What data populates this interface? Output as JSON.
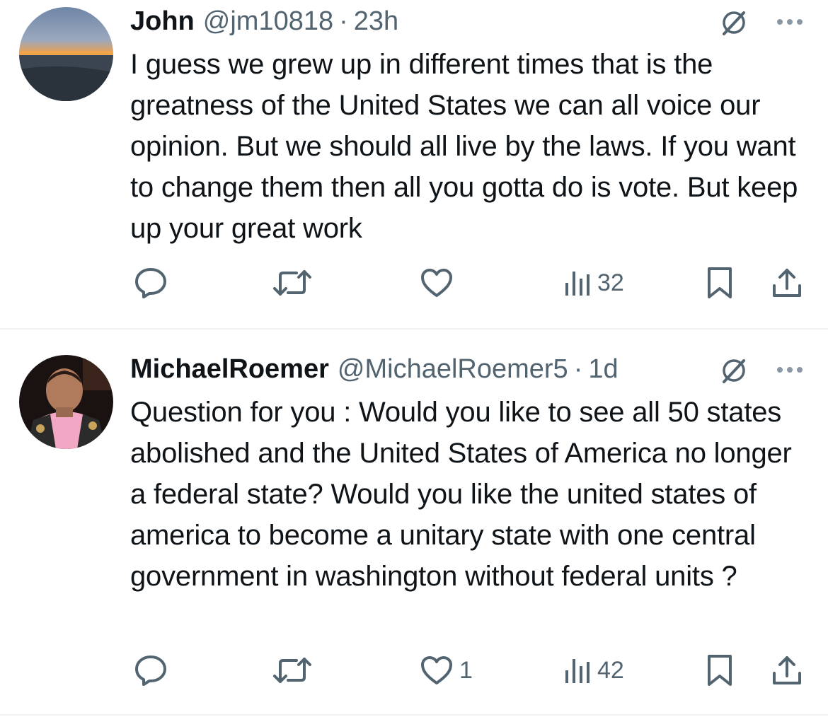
{
  "tweets": [
    {
      "name": "John",
      "handle": "@jm10818",
      "separator": "·",
      "time": "23h",
      "text": "I guess we grew up in different times that is the greatness of the United States we can all voice our opinion. But we should all live by the laws. If you want to change them then all you gotta do is vote. But keep up your great work",
      "views": "32",
      "likes": ""
    },
    {
      "name": "MichaelRoemer",
      "handle": "@MichaelRoemer5",
      "separator": "·",
      "time": "1d",
      "text": "Question for you : Would you like to see all 50 states abolished and the United States of America no longer a federal state? Would you like the united states of america to become a unitary state with one central government in washington without federal units ?",
      "views": "42",
      "likes": "1"
    }
  ],
  "icons": {
    "reply": "reply-icon",
    "repost": "repost-icon",
    "like": "heart-icon",
    "views": "views-icon",
    "bookmark": "bookmark-icon",
    "share": "share-icon",
    "grok": "grok-icon",
    "more": "more-icon"
  },
  "colors": {
    "text": "#0f1419",
    "secondary": "#536471",
    "divider": "#eff3f4"
  }
}
